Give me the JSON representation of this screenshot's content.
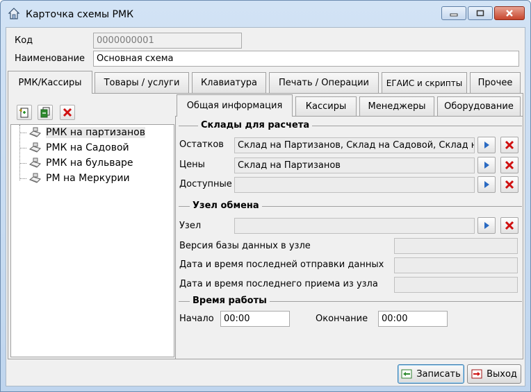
{
  "window": {
    "title": "Карточка схемы РМК"
  },
  "form": {
    "code_label": "Код",
    "code_value": "0000000001",
    "name_label": "Наименование",
    "name_value": "Основная схема"
  },
  "tabs": [
    {
      "label": "РМК/Кассиры",
      "active": true
    },
    {
      "label": "Товары / услуги"
    },
    {
      "label": "Клавиатура"
    },
    {
      "label": "Печать / Операции"
    },
    {
      "label": "ЕГАИС и скрипты"
    },
    {
      "label": "Прочее"
    }
  ],
  "subtabs": [
    {
      "label": "Общая информация",
      "active": true
    },
    {
      "label": "Кассиры"
    },
    {
      "label": "Менеджеры"
    },
    {
      "label": "Оборудование"
    }
  ],
  "toolbar_icons": [
    "add-icon",
    "copy-icon",
    "delete-icon"
  ],
  "tree": {
    "items": [
      "РМК на партизанов",
      "РМК на Садовой",
      "РМК на бульваре",
      "РМ на Меркурии"
    ],
    "selected_index": 0
  },
  "warehouses": {
    "title": "Склады для расчета",
    "remains_label": "Остатков",
    "remains_value": "Склад на Партизанов, Склад на Садовой, Склад на бул",
    "prices_label": "Цены",
    "prices_value": "Склад на Партизанов",
    "available_label": "Доступные",
    "available_value": ""
  },
  "exchange": {
    "title": "Узел обмена",
    "node_label": "Узел",
    "node_value": "",
    "db_version_label": "Версия базы данных в узле",
    "db_version_value": "",
    "last_sent_label": "Дата и время последней отправки данных",
    "last_sent_value": "",
    "last_received_label": "Дата и время последнего приема из узла",
    "last_received_value": ""
  },
  "work_time": {
    "title": "Время работы",
    "start_label": "Начало",
    "start_value": "00:00",
    "end_label": "Окончание",
    "end_value": "00:00"
  },
  "buttons": {
    "save": "Записать",
    "exit": "Выход"
  },
  "colors": {
    "title_gradient_top": "#d2e3f5",
    "close_red": "#c7452d",
    "arrow_blue": "#2a6ac2",
    "delete_red": "#d01010"
  }
}
